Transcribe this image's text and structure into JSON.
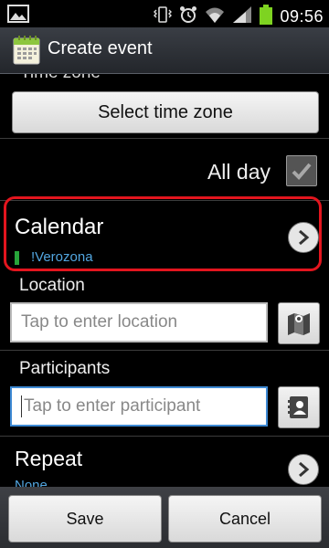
{
  "status_bar": {
    "time": "09:56",
    "icons": [
      "gallery-icon",
      "vibrate-icon",
      "alarm-icon",
      "wifi-icon",
      "signal-icon",
      "battery-icon"
    ]
  },
  "action_bar": {
    "title": "Create event",
    "icon": "calendar-app-icon"
  },
  "form": {
    "time_zone_label": "Time zone",
    "time_zone_button": "Select time zone",
    "all_day_label": "All day",
    "all_day_checked": true,
    "calendar_title": "Calendar",
    "calendar_value": "!Verozona",
    "calendar_color": "#27a53a",
    "location_label": "Location",
    "location_placeholder": "Tap to enter location",
    "participants_label": "Participants",
    "participants_placeholder": "Tap to enter participant",
    "repeat_title": "Repeat",
    "repeat_value": "None"
  },
  "bottom_bar": {
    "save_label": "Save",
    "cancel_label": "Cancel"
  },
  "colors": {
    "highlight": "#e3151e",
    "link_blue": "#52a6e0",
    "focus_blue": "#3e8ad4"
  }
}
